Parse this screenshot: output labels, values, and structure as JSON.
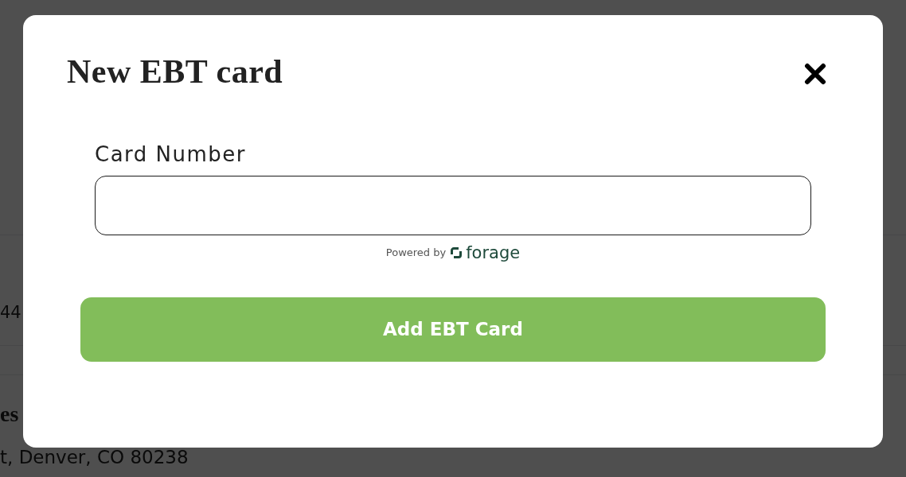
{
  "background_page": {
    "value_fragment": "44",
    "heading_fragment": "es",
    "address_fragment": "t, Denver, CO 80238"
  },
  "dialog": {
    "title": "New EBT card",
    "card_number_field": {
      "label": "Card Number"
    },
    "powered_by": {
      "text": "Powered by",
      "brand": "forage"
    },
    "submit_button": "Add EBT Card"
  }
}
